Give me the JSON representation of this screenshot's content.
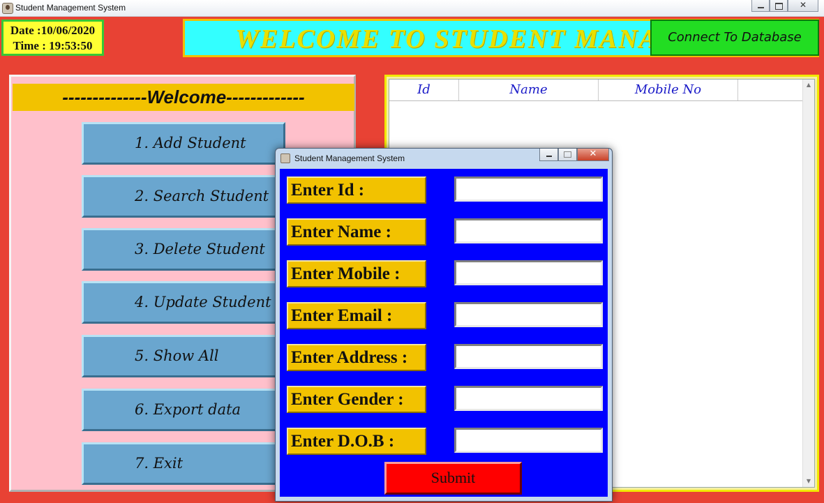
{
  "window": {
    "title": "Student Management System"
  },
  "datetime": {
    "date": "Date :10/06/2020",
    "time": "Time : 19:53:50"
  },
  "banner": {
    "text": "WELCOME TO STUDENT MANAGEMENT SYSTEM",
    "connect_label": "Connect To Database"
  },
  "menu": {
    "heading": "--------------Welcome-------------",
    "items": [
      {
        "label": "1. Add Student"
      },
      {
        "label": "2. Search Student"
      },
      {
        "label": "3. Delete Student"
      },
      {
        "label": "4. Update Student"
      },
      {
        "label": "5. Show All"
      },
      {
        "label": "6. Export data"
      },
      {
        "label": "7.  Exit"
      }
    ]
  },
  "table": {
    "columns": [
      "Id",
      "Name",
      "Mobile No"
    ],
    "rows": []
  },
  "dialog": {
    "title": "Student Management System",
    "fields": [
      {
        "label": "Enter Id :",
        "value": ""
      },
      {
        "label": "Enter Name :",
        "value": ""
      },
      {
        "label": "Enter Mobile :",
        "value": ""
      },
      {
        "label": "Enter Email :",
        "value": ""
      },
      {
        "label": "Enter Address :",
        "value": ""
      },
      {
        "label": "Enter Gender :",
        "value": ""
      },
      {
        "label": "Enter D.O.B :",
        "value": ""
      }
    ],
    "submit_label": "Submit"
  },
  "colors": {
    "background": "#e84234",
    "banner_bg": "#33ffff",
    "banner_text": "#e8e000",
    "connect_bg": "#22dd22",
    "menu_panel": "#ffc0cb",
    "menu_heading_bg": "#f2c200",
    "menu_button": "#6aa6cf",
    "dialog_bg": "#0000ff",
    "submit_bg": "#ff0000",
    "table_header_text": "#1a1ac8"
  },
  "icons": [
    "app-icon",
    "minimize-icon",
    "maximize-icon",
    "close-icon",
    "scroll-up-icon",
    "scroll-down-icon"
  ]
}
